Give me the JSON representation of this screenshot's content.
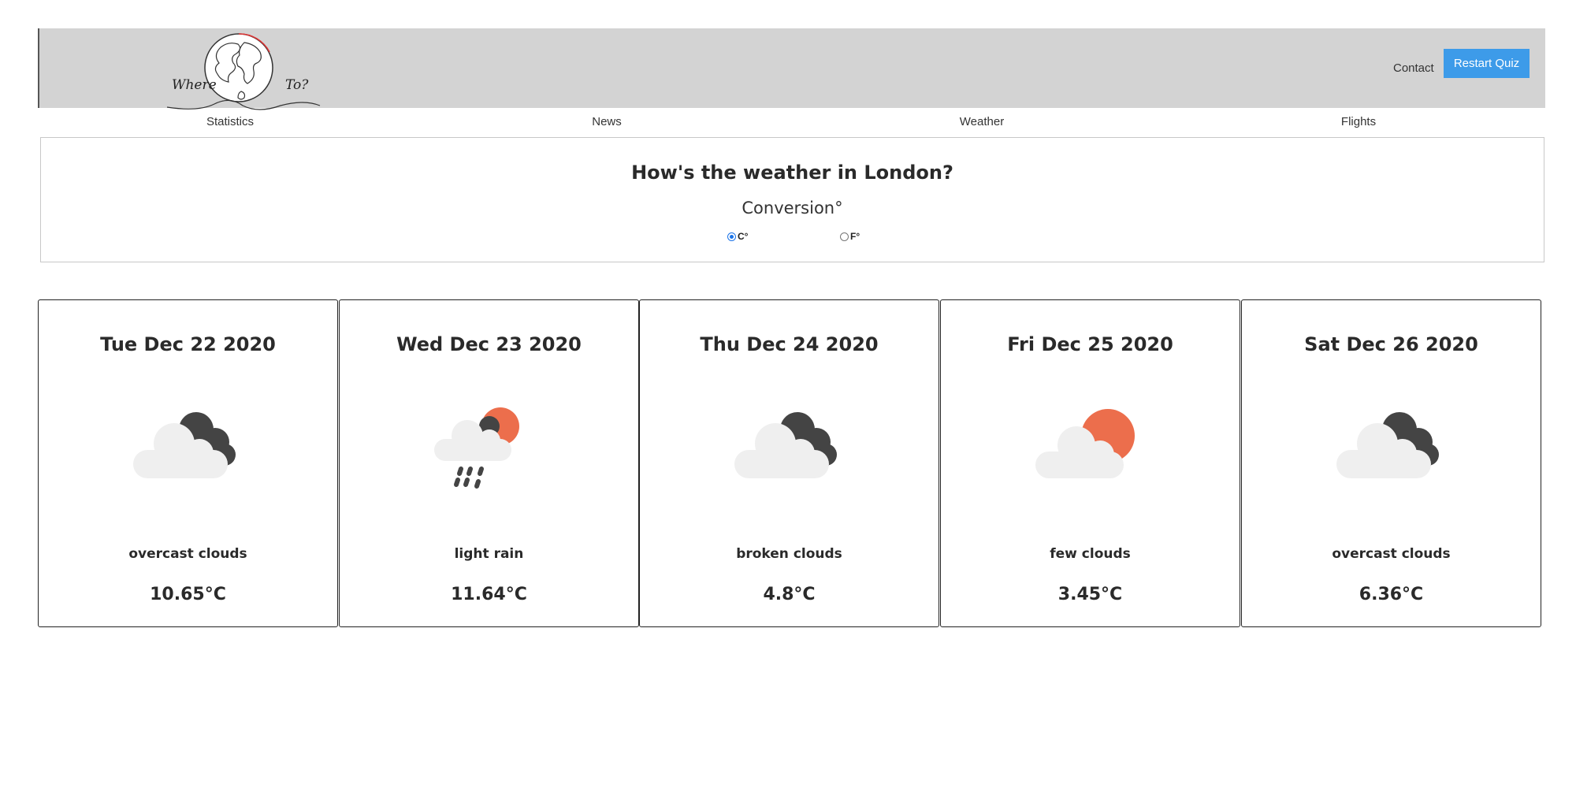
{
  "header": {
    "logo_left": "Where",
    "logo_right": "To?",
    "contact_label": "Contact",
    "restart_label": "Restart Quiz"
  },
  "nav": [
    {
      "label": "Statistics"
    },
    {
      "label": "News"
    },
    {
      "label": "Weather"
    },
    {
      "label": "Flights"
    }
  ],
  "panel": {
    "title": "How's the weather in London?",
    "subtitle": "Conversion°",
    "options": [
      {
        "label": "C°",
        "checked": true
      },
      {
        "label": "F°",
        "checked": false
      }
    ]
  },
  "forecast": [
    {
      "date": "Tue Dec 22 2020",
      "icon": "overcast-clouds-icon",
      "description": "overcast clouds",
      "temp": "10.65°C"
    },
    {
      "date": "Wed Dec 23 2020",
      "icon": "light-rain-icon",
      "description": "light rain",
      "temp": "11.64°C"
    },
    {
      "date": "Thu Dec 24 2020",
      "icon": "broken-clouds-icon",
      "description": "broken clouds",
      "temp": "4.8°C"
    },
    {
      "date": "Fri Dec 25 2020",
      "icon": "few-clouds-icon",
      "description": "few clouds",
      "temp": "3.45°C"
    },
    {
      "date": "Sat Dec 26 2020",
      "icon": "overcast-clouds-icon",
      "description": "overcast clouds",
      "temp": "6.36°C"
    }
  ],
  "colors": {
    "header_bg": "#d3d3d3",
    "button": "#3d9be9",
    "sun": "#ec6e4c",
    "dark_cloud": "#444444",
    "light_cloud": "#efefef"
  }
}
